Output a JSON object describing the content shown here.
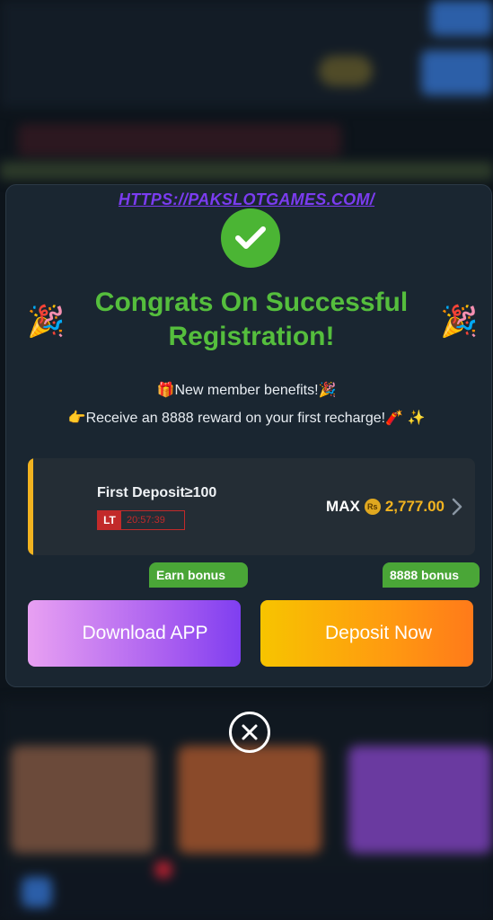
{
  "url_text": "HTTPS://PAKSLOTGAMES.COM/",
  "title": "Congrats On Successful Registration!",
  "benefits": {
    "line1": "🎁New member benefits!🎉",
    "line2": "👉Receive an 8888 reward on your first recharge!🧨 ✨"
  },
  "deposit": {
    "label": "First Deposit≥100",
    "timer_prefix": "LT",
    "timer": "20:57:39",
    "max_label": "MAX",
    "currency_badge": "Rs",
    "amount": "2,777.00"
  },
  "tags": {
    "left": "Earn bonus",
    "right": "8888 bonus"
  },
  "buttons": {
    "download": "Download APP",
    "deposit": "Deposit Now"
  },
  "colors": {
    "accent_green": "#55be3d",
    "gold": "#f2b320",
    "link_purple": "#7b3cf0"
  }
}
